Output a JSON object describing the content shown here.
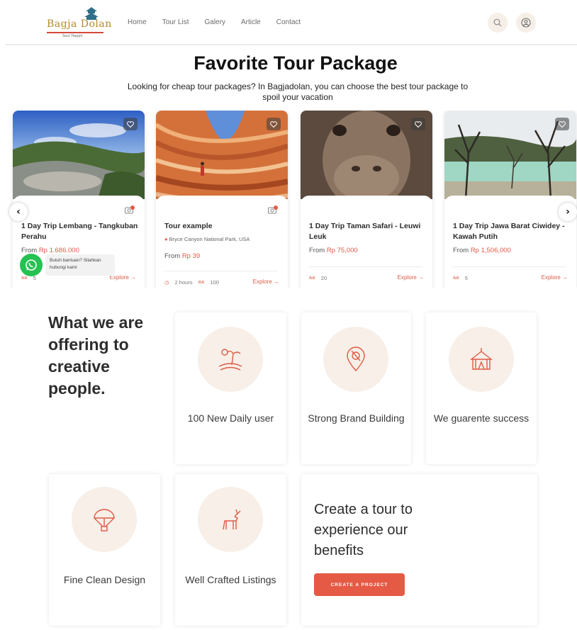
{
  "brand": {
    "name": "Bagja Dolan",
    "tagline": "Soul Happh"
  },
  "nav": {
    "items": [
      "Home",
      "Tour List",
      "Galery",
      "Article",
      "Contact"
    ]
  },
  "hero": {
    "title": "Favorite Tour Package",
    "subtitle": "Looking for cheap tour packages? In Bagjadolan, you can choose the best tour package to spoil your vacation"
  },
  "tours": [
    {
      "title": "1 Day Trip Lembang - Tangkuban Perahu",
      "price_prefix": "From",
      "price": "Rp 1.686.000",
      "capacity": "5",
      "explore": "Explore →"
    },
    {
      "title": "Tour example",
      "location": "Bryce Canyon National Park, USA",
      "price_prefix": "From",
      "price": "Rp 39",
      "duration": "2 hours",
      "capacity": "100",
      "explore": "Explore →"
    },
    {
      "title": "1 Day Trip Taman Safari - Leuwi Leuk",
      "price_prefix": "From",
      "price": "Rp 75,000",
      "capacity": "20",
      "explore": "Explore →"
    },
    {
      "title": "1 Day Trip Jawa Barat Ciwidey - Kawah Putih",
      "price_prefix": "From",
      "price": "Rp 1,506,000",
      "capacity": "5",
      "explore": "Explore →"
    }
  ],
  "whatsapp": {
    "text": "Butuh bantuan? Silahkan hubungi kami"
  },
  "offering": {
    "title": "What we are offering to creative people.",
    "features": [
      {
        "label": "100 New Daily user",
        "icon": "island-icon"
      },
      {
        "label": "Strong Brand Building",
        "icon": "map-pin-icon"
      },
      {
        "label": "We guarente success",
        "icon": "circus-tent-icon"
      },
      {
        "label": "Fine Clean Design",
        "icon": "parachute-icon"
      },
      {
        "label": "Well Crafted Listings",
        "icon": "deer-icon"
      }
    ],
    "cta": {
      "title": "Create a tour to experience our benefits",
      "button": "CREATE A PROJECT"
    }
  },
  "colors": {
    "accent": "#e55a45",
    "brand_gold": "#b7892a",
    "whatsapp": "#25c152",
    "soft_circle": "#f7efe8"
  }
}
